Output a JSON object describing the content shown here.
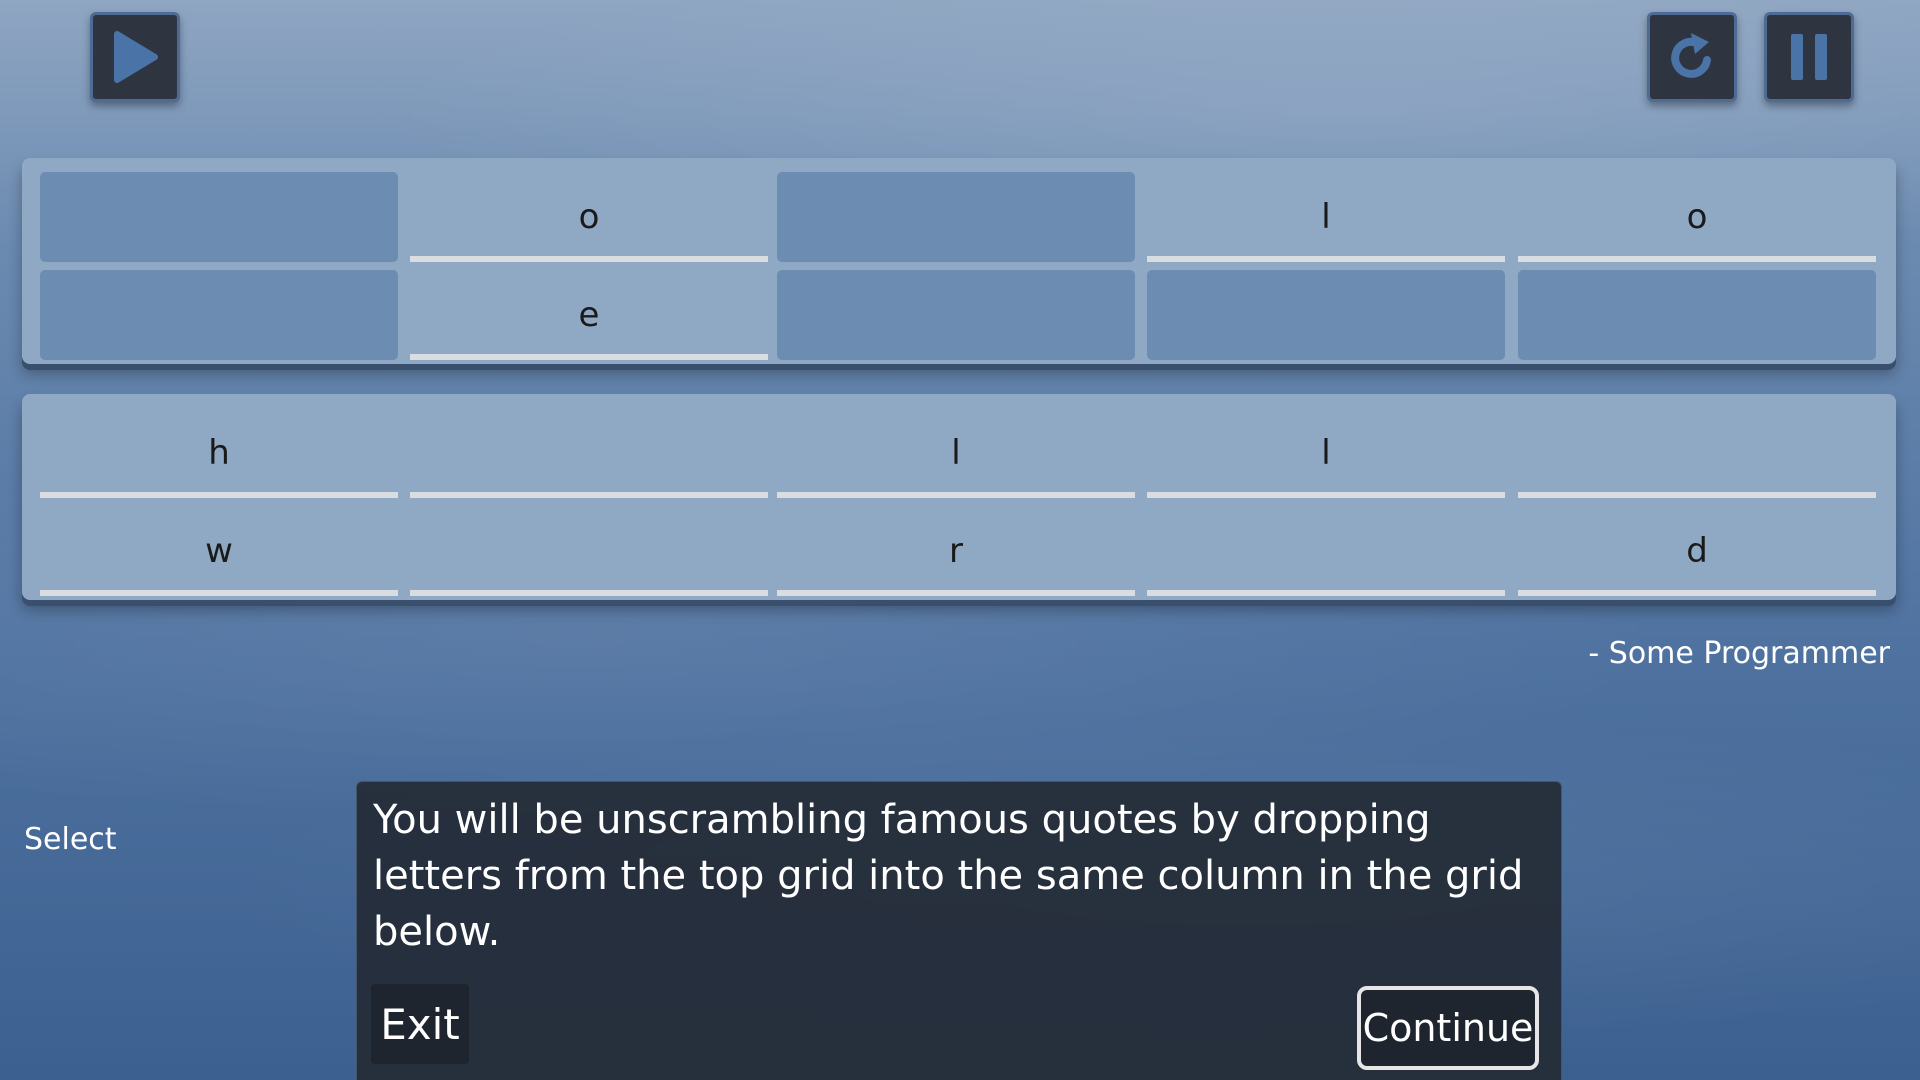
{
  "toolbar": {
    "play_icon": "play-icon",
    "restart_icon": "restart-icon",
    "pause_icon": "pause-icon"
  },
  "top_grid": {
    "rows": [
      [
        "",
        "o",
        "",
        "l",
        "o"
      ],
      [
        "",
        "e",
        "",
        "",
        ""
      ]
    ]
  },
  "bottom_grid": {
    "rows": [
      [
        "h",
        "",
        "l",
        "l",
        ""
      ],
      [
        "w",
        "",
        "r",
        "",
        "d"
      ]
    ]
  },
  "attribution": "- Some Programmer",
  "side_label": "Select",
  "dialog": {
    "text": "You will be unscrambling famous quotes by dropping letters from the top grid into the same column in the grid below.",
    "exit_label": "Exit",
    "continue_label": "Continue"
  },
  "colors": {
    "button_bg": "#2e3440",
    "button_icon": "#4a73a8",
    "panel": "#8fa9c5",
    "empty_cell": "#6c8cb2",
    "dialog_bg": "#252c38"
  }
}
